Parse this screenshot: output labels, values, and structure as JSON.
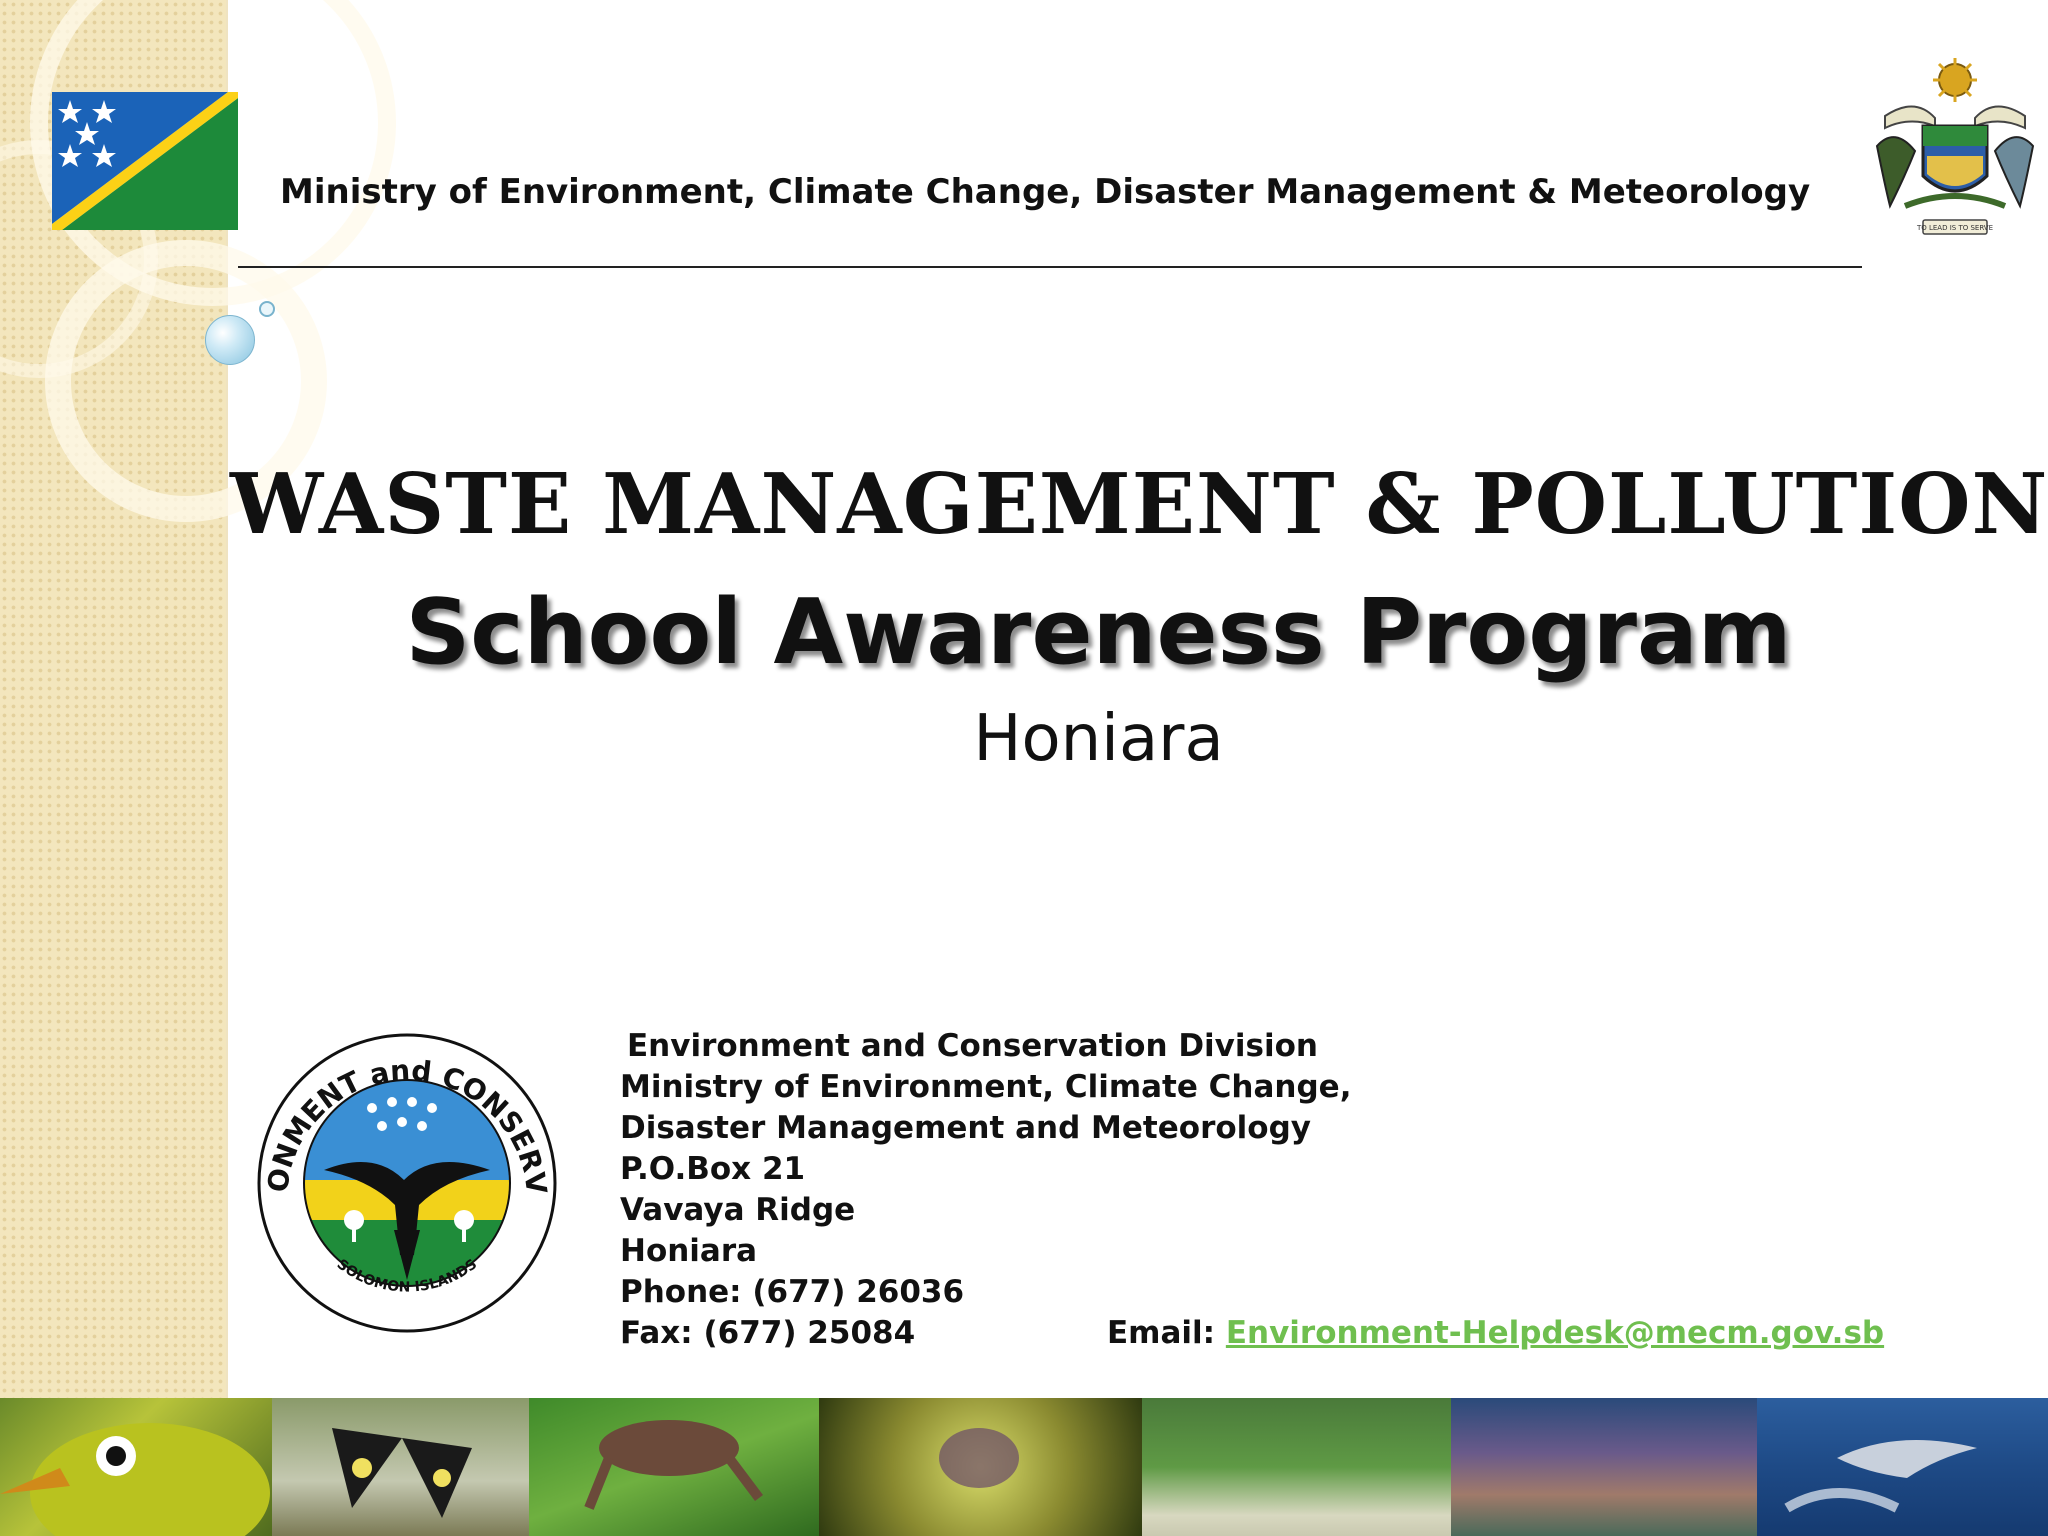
{
  "header": {
    "ministry": "Ministry of Environment, Climate Change, Disaster Management & Meteorology"
  },
  "titles": {
    "main": "WASTE MANAGEMENT & POLLUTION",
    "sub": "School Awareness Program",
    "location": "Honiara"
  },
  "division_logo": {
    "top_text": "ENVIRONMENT and CONSERVATION",
    "bottom_text": "SOLOMON ISLANDS"
  },
  "crest": {
    "motto": "TO LEAD IS TO SERVE"
  },
  "contact": {
    "lines": [
      "Environment and Conservation Division",
      "Ministry of Environment, Climate Change,",
      "Disaster Management and Meteorology",
      "P.O.Box 21",
      "Vavaya Ridge",
      "Honiara",
      "Phone: (677) 26036",
      "Fax: (677) 25084"
    ],
    "email_label": "Email:",
    "email": "Environment-Helpdesk@mecm.gov.sb"
  },
  "photos": [
    "bird",
    "butterfly",
    "frog",
    "orchid",
    "mangrove",
    "coral-reef",
    "dolphin"
  ],
  "colors": {
    "flag_blue": "#1b63b8",
    "flag_green": "#1d8a3a",
    "flag_yellow": "#fcd116",
    "email_link": "#6fbf4f",
    "side_strip": "#f3e6bd"
  }
}
